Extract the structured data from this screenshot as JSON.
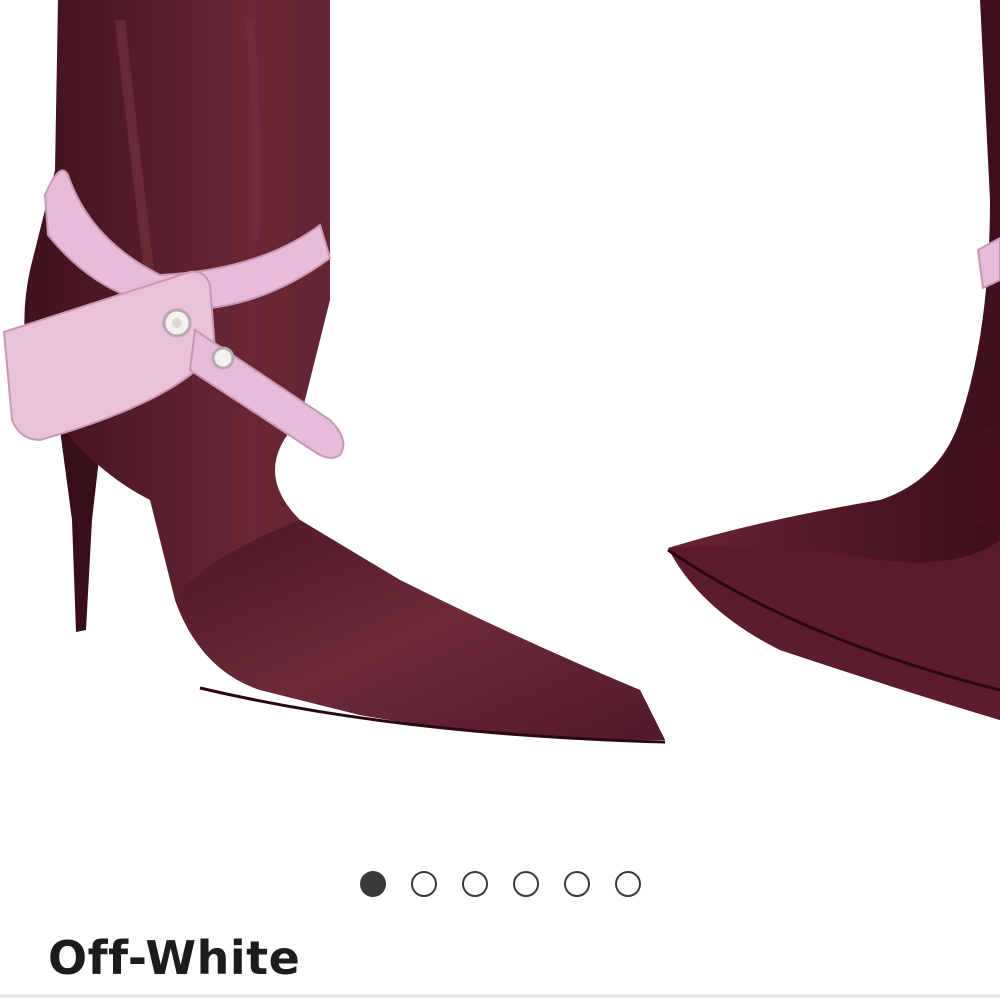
{
  "product": {
    "brand": "Off-White",
    "image_icon": "ankle-boot-image",
    "colors": {
      "boot": "#5a1f2c",
      "strap": "#e6bcd8",
      "active_dot": "#3a3a3a"
    }
  },
  "carousel": {
    "total_images": 6,
    "current_index": 1,
    "dots": [
      {
        "state": "active"
      },
      {
        "state": "inactive"
      },
      {
        "state": "inactive"
      },
      {
        "state": "inactive"
      },
      {
        "state": "inactive"
      },
      {
        "state": "inactive"
      }
    ]
  }
}
